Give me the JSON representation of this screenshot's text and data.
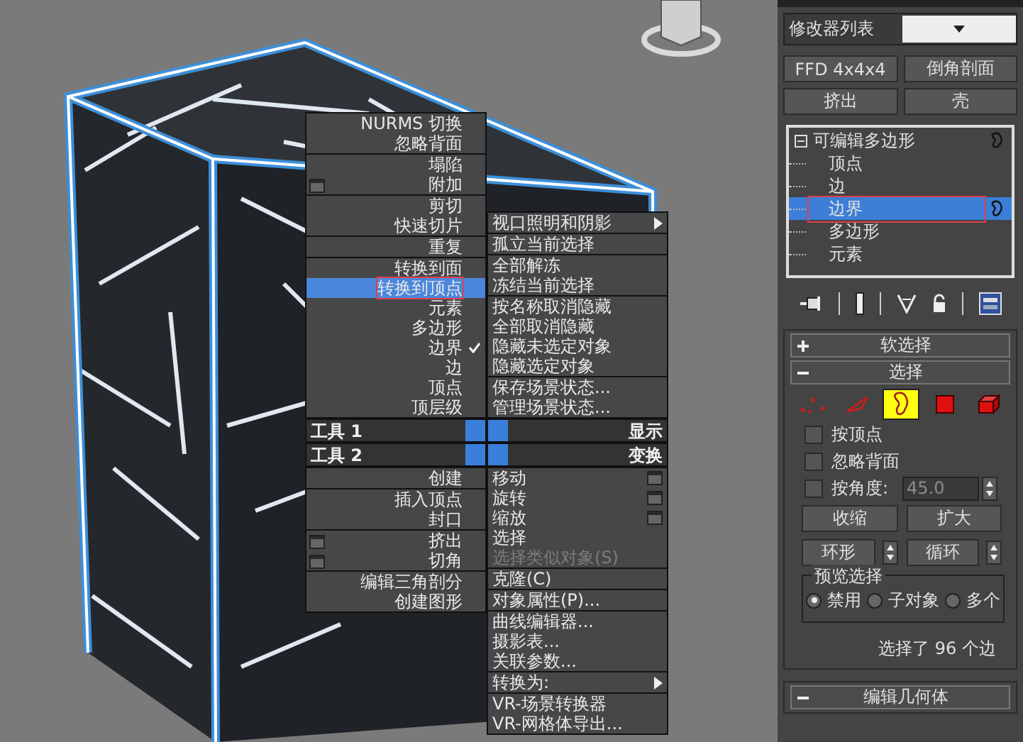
{
  "quad_menu": {
    "quadrants": [
      {
        "title": "工具 1",
        "groups": [
          [
            {
              "label": "NURMS 切换",
              "kind": "plain",
              "selected": false,
              "checked": false
            },
            {
              "label": "忽略背面",
              "kind": "plain",
              "selected": false,
              "checked": false
            }
          ],
          [
            {
              "label": "塌陷",
              "kind": "plain",
              "selected": false,
              "checked": false
            },
            {
              "label": "附加",
              "kind": "option",
              "selected": false,
              "checked": false
            }
          ],
          [
            {
              "label": "剪切",
              "kind": "plain",
              "selected": false,
              "checked": false
            },
            {
              "label": "快速切片",
              "kind": "plain",
              "selected": false,
              "checked": false
            }
          ],
          [
            {
              "label": "重复",
              "kind": "plain",
              "selected": false,
              "checked": false
            }
          ],
          [
            {
              "label": "转换到面",
              "kind": "plain",
              "selected": false,
              "checked": false
            },
            {
              "label": "转换到顶点",
              "kind": "plain",
              "selected": true,
              "checked": false
            },
            {
              "label": "元素",
              "kind": "plain",
              "selected": false,
              "checked": false
            },
            {
              "label": "多边形",
              "kind": "plain",
              "selected": false,
              "checked": false
            },
            {
              "label": "边界",
              "kind": "plain",
              "selected": false,
              "checked": true
            },
            {
              "label": "边",
              "kind": "plain",
              "selected": false,
              "checked": false
            },
            {
              "label": "顶点",
              "kind": "plain",
              "selected": false,
              "checked": false
            },
            {
              "label": "顶层级",
              "kind": "plain",
              "selected": false,
              "checked": false
            }
          ]
        ]
      },
      {
        "title": "显示",
        "groups": [
          [
            {
              "label": "视口照明和阴影",
              "kind": "submenu",
              "selected": false
            }
          ],
          [
            {
              "label": "孤立当前选择",
              "kind": "plain",
              "selected": false
            }
          ],
          [
            {
              "label": "全部解冻",
              "kind": "plain",
              "selected": false
            },
            {
              "label": "冻结当前选择",
              "kind": "plain",
              "selected": false
            }
          ],
          [
            {
              "label": "按名称取消隐藏",
              "kind": "plain",
              "selected": false
            },
            {
              "label": "全部取消隐藏",
              "kind": "plain",
              "selected": false
            },
            {
              "label": "隐藏未选定对象",
              "kind": "plain",
              "selected": false
            },
            {
              "label": "隐藏选定对象",
              "kind": "plain",
              "selected": false
            }
          ],
          [
            {
              "label": "保存场景状态...",
              "kind": "plain",
              "selected": false
            },
            {
              "label": "管理场景状态...",
              "kind": "plain",
              "selected": false
            }
          ]
        ]
      },
      {
        "title": "工具 2",
        "groups": [
          [
            {
              "label": "创建",
              "kind": "plain",
              "selected": false
            }
          ],
          [
            {
              "label": "插入顶点",
              "kind": "plain",
              "selected": false
            },
            {
              "label": "封口",
              "kind": "plain",
              "selected": false
            }
          ],
          [
            {
              "label": "挤出",
              "kind": "option",
              "selected": false
            },
            {
              "label": "切角",
              "kind": "option",
              "selected": false
            }
          ],
          [
            {
              "label": "编辑三角剖分",
              "kind": "plain",
              "selected": false
            },
            {
              "label": "创建图形",
              "kind": "plain",
              "selected": false
            }
          ]
        ]
      },
      {
        "title": "变换",
        "groups": [
          [
            {
              "label": "移动",
              "kind": "option",
              "selected": false,
              "disabled": false
            },
            {
              "label": "旋转",
              "kind": "option",
              "selected": false,
              "disabled": false
            },
            {
              "label": "缩放",
              "kind": "option",
              "selected": false,
              "disabled": false
            },
            {
              "label": "选择",
              "kind": "plain",
              "selected": false,
              "disabled": false
            },
            {
              "label": "选择类似对象(S)",
              "kind": "plain",
              "selected": false,
              "disabled": true
            }
          ],
          [
            {
              "label": "克隆(C)",
              "kind": "plain",
              "selected": false,
              "disabled": false
            }
          ],
          [
            {
              "label": "对象属性(P)...",
              "kind": "plain",
              "selected": false,
              "disabled": false
            }
          ],
          [
            {
              "label": "曲线编辑器...",
              "kind": "plain",
              "selected": false,
              "disabled": false
            },
            {
              "label": "摄影表...",
              "kind": "plain",
              "selected": false,
              "disabled": false
            },
            {
              "label": "关联参数...",
              "kind": "plain",
              "selected": false,
              "disabled": false
            }
          ],
          [
            {
              "label": "转换为:",
              "kind": "submenu",
              "selected": false,
              "disabled": false
            }
          ],
          [
            {
              "label": "VR-场景转换器",
              "kind": "plain",
              "selected": false,
              "disabled": false
            },
            {
              "label": "VR-网格体导出...",
              "kind": "plain",
              "selected": false,
              "disabled": false
            }
          ]
        ]
      }
    ]
  },
  "command_panel": {
    "modifier_list": "修改器列表",
    "modifier_buttons": [
      "FFD 4x4x4",
      "倒角剖面",
      "挤出",
      "壳"
    ],
    "stack": [
      {
        "label": "可编辑多边形",
        "selected": false,
        "expanded": true,
        "children": [
          {
            "label": "顶点",
            "selected": false
          },
          {
            "label": "边",
            "selected": false
          },
          {
            "label": "边界",
            "selected": true
          },
          {
            "label": "多边形",
            "selected": false
          },
          {
            "label": "元素",
            "selected": false
          }
        ]
      }
    ],
    "rollouts": [
      {
        "title": "软选择",
        "expanded": false
      },
      {
        "title": "选择",
        "expanded": true
      }
    ],
    "selection": {
      "modes": [
        {
          "kind": "vertex",
          "selected": false
        },
        {
          "kind": "edge",
          "selected": false
        },
        {
          "kind": "border",
          "selected": true
        },
        {
          "kind": "polygon",
          "selected": false
        },
        {
          "kind": "element",
          "selected": false
        }
      ],
      "checkboxes": [
        {
          "label": "按顶点",
          "checked": false
        },
        {
          "label": "忽略背面",
          "checked": false
        },
        {
          "label": "按角度:",
          "checked": false,
          "value": "45.0"
        }
      ],
      "buttons": [
        {
          "label": "收缩",
          "spinner": false
        },
        {
          "label": "扩大",
          "spinner": false
        },
        {
          "label": "环形",
          "spinner": true
        },
        {
          "label": "循环",
          "spinner": true
        }
      ],
      "preview": {
        "title": "预览选择",
        "options": [
          {
            "label": "禁用",
            "selected": true
          },
          {
            "label": "子对象",
            "selected": false
          },
          {
            "label": "多个",
            "selected": false
          }
        ]
      },
      "status": "选择了 96 个边"
    },
    "bottom_rollout": {
      "title": "编辑几何体",
      "expanded": true
    }
  }
}
